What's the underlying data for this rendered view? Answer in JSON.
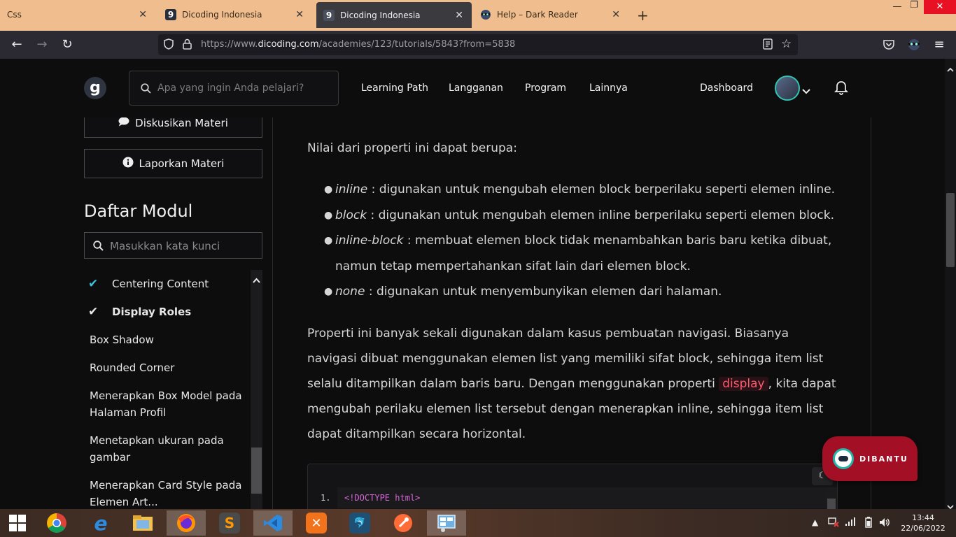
{
  "browser": {
    "tabs": [
      {
        "title": "Css",
        "favicon": "generic-page-icon"
      },
      {
        "title": "Dicoding Indonesia",
        "favicon": "dicoding-icon"
      },
      {
        "title": "Dicoding Indonesia",
        "favicon": "dicoding-icon",
        "active": true
      },
      {
        "title": "Help – Dark Reader",
        "favicon": "dark-reader-icon"
      }
    ],
    "url_prefix": "https://www.",
    "url_domain": "dicoding.com",
    "url_path": "/academies/123/tutorials/5843?from=5838"
  },
  "header": {
    "logo_text": "g",
    "search_placeholder": "Apa yang ingin Anda pelajari?",
    "nav": [
      "Learning Path",
      "Langganan",
      "Program",
      "Lainnya"
    ],
    "dashboard": "Dashboard"
  },
  "sidebar": {
    "discuss_label": "Diskusikan Materi",
    "report_label": "Laporkan Materi",
    "module_title": "Daftar Modul",
    "module_search_placeholder": "Masukkan kata kunci",
    "items": [
      {
        "label": "Centering Content",
        "status": "done"
      },
      {
        "label": "Display Roles",
        "status": "current"
      },
      {
        "label": "Box Shadow"
      },
      {
        "label": "Rounded Corner"
      },
      {
        "label_line1": "Menerapkan Box Model pada",
        "label_line2": "Halaman Profil"
      },
      {
        "label_line1": "Menetapkan ukuran pada",
        "label_line2": "gambar"
      },
      {
        "label_line1": "Menerapkan Card Style pada",
        "label_line2": "Elemen Art..."
      }
    ]
  },
  "content": {
    "intro": "Nilai dari properti ini dapat berupa:",
    "list": [
      {
        "term": "inline",
        "desc": " : digunakan untuk mengubah elemen block berperilaku seperti elemen inline."
      },
      {
        "term": "block",
        "desc": " : digunakan untuk mengubah elemen inline berperilaku seperti elemen block."
      },
      {
        "term": "inline-block",
        "desc_line1": " : membuat elemen block tidak menambahkan baris baru ketika dibuat,",
        "desc_line2": "namun tetap mempertahankan sifat lain dari elemen block."
      },
      {
        "term": "none",
        "desc": " : digunakan untuk menyembunyikan elemen dari halaman."
      }
    ],
    "para_lines": [
      "Properti ini banyak sekali digunakan dalam kasus pembuatan navigasi. Biasanya",
      "navigasi dibuat menggunakan elemen list yang memiliki sifat block, sehingga item list",
      "selalu ditampilkan dalam baris baru. Dengan menggunakan properti ",
      "mengubah perilaku elemen list tersebut dengan menerapkan inline, sehingga item list",
      "dapat ditampilkan secara horizontal."
    ],
    "inline_code": "display",
    "after_code": ", kita dapat",
    "code_line_number": "1.",
    "code_line": "<!DOCTYPE html>"
  },
  "widget": {
    "label": "DIBANTU"
  },
  "taskbar": {
    "time": "13:44",
    "date": "22/06/2022",
    "apps": [
      "start-icon",
      "chrome-icon",
      "ie-icon",
      "explorer-icon",
      "firefox-icon",
      "sublime-icon",
      "vscode-icon",
      "xampp-icon",
      "mysql-workbench-icon",
      "postman-icon",
      "control-panel-icon"
    ]
  },
  "colors": {
    "accent_code": "#ff5a6e",
    "done_check": "#3fbfd9",
    "widget_bg": "#a30f24",
    "tabstrip": "#f0be8e"
  }
}
